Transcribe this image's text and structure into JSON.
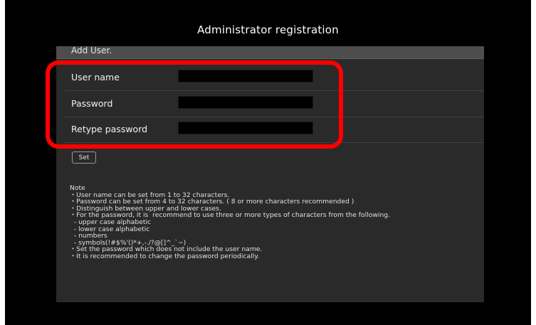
{
  "title": "Administrator registration",
  "section_header": "Add User.",
  "form": {
    "rows": [
      {
        "label": "User name",
        "value": ""
      },
      {
        "label": "Password",
        "value": ""
      },
      {
        "label": "Retype password",
        "value": ""
      }
    ]
  },
  "set_button_label": "Set",
  "notes": {
    "heading": "Note",
    "lines": [
      "・User name can be set from 1 to 32 characters.",
      "・Password can be set from 4 to 32 characters. ( 8 or more characters recommended )",
      "・Distinguish between upper and lower cases.",
      "・For the password, it is  recommend to use three or more types of characters from the following.",
      "  - upper case alphabetic",
      "  - lower case alphabetic",
      "  - numbers",
      "  - symbols(!#$%'()*+,-./?@[]^_`~)",
      "・Set the password which does not include the user name.",
      "・It is recommended to change the password periodically."
    ]
  },
  "colors": {
    "background": "#000000",
    "panel": "#2a2a2a",
    "panel_header": "#4d4d4d",
    "highlight": "#ff0000"
  }
}
